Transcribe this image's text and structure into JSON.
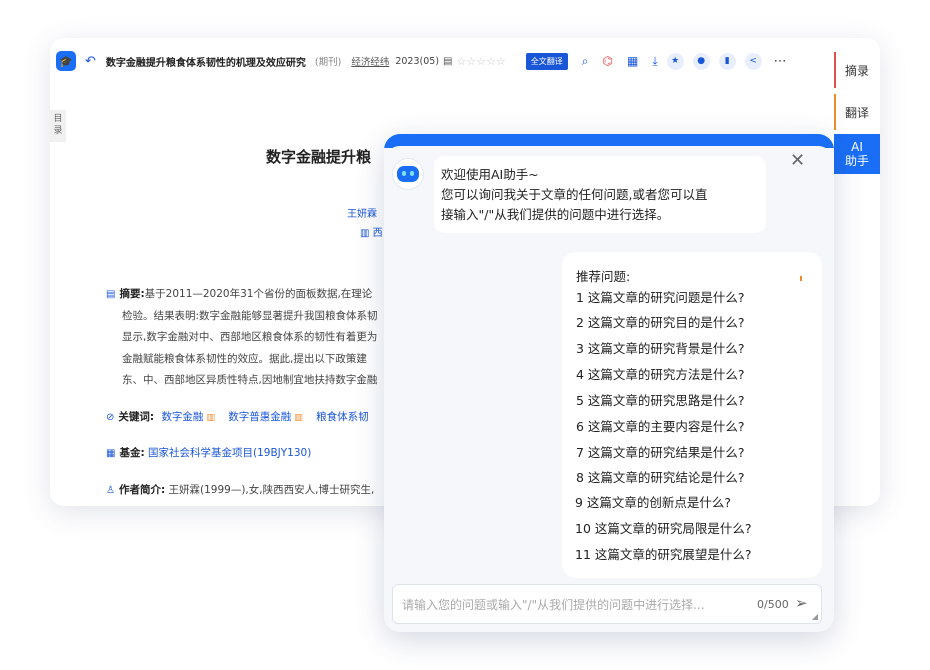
{
  "reader": {
    "logo_glyph": "🎓",
    "back_glyph": "↶",
    "article_title": "数字金融提升粮食体系韧性的机理及效应研究",
    "article_type": "(期刊)",
    "journal": "经济经纬",
    "issue": "2023(05)",
    "rating_stars": "☆☆☆☆☆",
    "translate_button": "全文翻译",
    "toc_label": "目录",
    "doc_title": "数字金融提升粮",
    "author": "王妍霖",
    "institution": "西",
    "abstract_label": "摘要:",
    "abstract_lines": [
      "基于2011—2020年31个省份的面板数据,在理论",
      "检验。结果表明:数字金融能够显著提升我国粮食体系韧",
      "显示,数字金融对中、西部地区粮食体系的韧性有着更为",
      "金融赋能粮食体系韧性的效应。据此,提出以下政策建",
      "东、中、西部地区异质性特点,因地制宜地扶持数字金融"
    ],
    "keywords_label": "关键词:",
    "keywords": [
      "数字金融",
      "数字普惠金融",
      "粮食体系韧"
    ],
    "fund_label": "基金:",
    "fund_value": "国家社会科学基金项目(19BJY130)",
    "author_intro_label": "作者简介:",
    "author_intro_value": "王妍霖(1999—),女,陕西西安人,博士研究生,"
  },
  "side_tabs": {
    "abstract": "摘录",
    "translate": "翻译",
    "ai_line1": "AI",
    "ai_line2": "助手"
  },
  "chat": {
    "close_glyph": "✕",
    "welcome_lines": [
      "欢迎使用AI助手~",
      "您可以询问我关于文章的任何问题,或者您可以直",
      "接输入\"/\"从我们提供的问题中进行选择。"
    ],
    "suggest_title": "推荐问题:",
    "questions": [
      "1 这篇文章的研究问题是什么?",
      "2 这篇文章的研究目的是什么?",
      "3 这篇文章的研究背景是什么?",
      "4 这篇文章的研究方法是什么?",
      "5 这篇文章的研究思路是什么?",
      "6 这篇文章的主要内容是什么?",
      "7 这篇文章的研究结果是什么?",
      "8 这篇文章的研究结论是什么?",
      "9 这篇文章的创新点是什么?",
      "10 这篇文章的研究局限是什么?",
      "11 这篇文章的研究展望是什么?"
    ],
    "input_placeholder": "请输入您的问题或输入\"/\"从我们提供的问题中进行选择...",
    "char_counter": "0/500",
    "send_glyph": "➢"
  }
}
